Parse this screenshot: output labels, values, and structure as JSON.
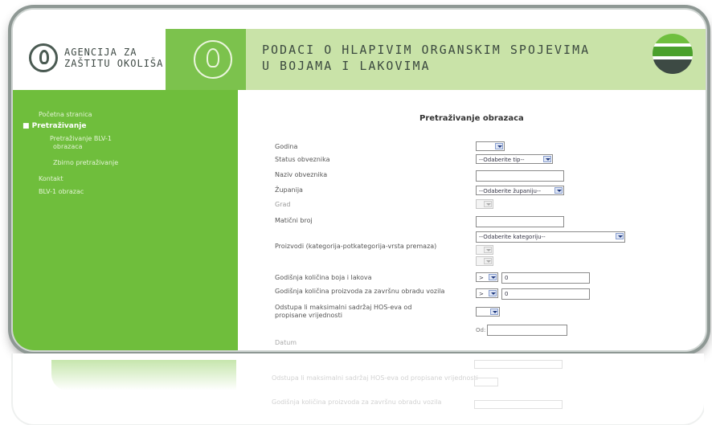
{
  "header": {
    "logo_line1": "AGENCIJA ZA",
    "logo_line2": "ZAŠTITU OKOLIŠA",
    "title_line1": "PODACI O HLAPIVIM ORGANSKIM SPOJEVIMA",
    "title_line2": "U BOJAMA I LAKOVIMA"
  },
  "sidebar": {
    "items": [
      {
        "label": "Početna stranica",
        "active": false
      },
      {
        "label": "■ Pretraživanje",
        "active": true
      },
      {
        "label": "Pretraživanje BLV-1",
        "active": false
      },
      {
        "label": "obrazaca",
        "active": false
      },
      {
        "label": "Zbirno pretraživanje",
        "active": false
      },
      {
        "label": "Kontakt",
        "active": false
      },
      {
        "label": "BLV-1 obrazac",
        "active": false
      }
    ]
  },
  "form": {
    "title": "Pretraživanje obrazaca",
    "fields": {
      "godina": {
        "label": "Godina",
        "value": ""
      },
      "status": {
        "label": "Status obveznika",
        "value": "--Odaberite tip--"
      },
      "naziv": {
        "label": "Naziv obveznika",
        "value": ""
      },
      "zupanija": {
        "label": "Županija",
        "value": "--Odaberite županiju--"
      },
      "grad": {
        "label": "Grad",
        "value": ""
      },
      "maticni": {
        "label": "Matični broj",
        "value": ""
      },
      "proizvodi": {
        "label": "Proizvodi (kategorija-potkategorija-vrsta premaza)",
        "value": "--Odaberite kategoriju--"
      },
      "godisnja_boja": {
        "label": "Godišnja količina boja i lakova",
        "operator": ">",
        "value": "0"
      },
      "godisnja_vozila": {
        "label": "Godišnja količina proizvoda za završnu obradu vozila",
        "operator": ">",
        "value": "0"
      },
      "odstupa": {
        "label": "Odstupa li maksimalni sadržaj HOS-eva od propisane vrijednosti",
        "value": ""
      },
      "od": {
        "label": "Od:",
        "value": ""
      },
      "last_label": {
        "label": "Datum",
        "value": ""
      }
    }
  },
  "colors": {
    "sidebar_green": "#6fbe3c",
    "band_light_green": "#c9e3a8",
    "band_dark_green": "#7cc24d"
  }
}
